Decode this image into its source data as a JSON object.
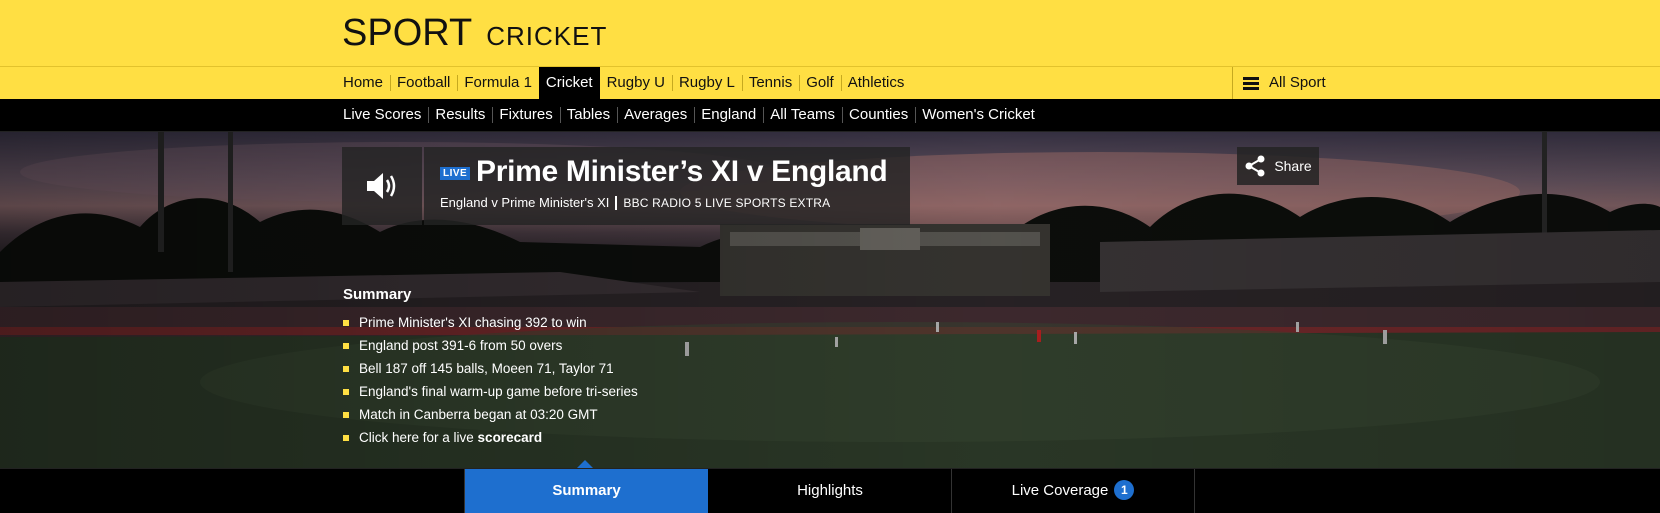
{
  "masthead": {
    "brand": "SPORT",
    "section": "CRICKET"
  },
  "primary_nav": {
    "items": [
      {
        "label": "Home"
      },
      {
        "label": "Football"
      },
      {
        "label": "Formula 1"
      },
      {
        "label": "Cricket",
        "active": true
      },
      {
        "label": "Rugby U"
      },
      {
        "label": "Rugby L"
      },
      {
        "label": "Tennis"
      },
      {
        "label": "Golf"
      },
      {
        "label": "Athletics"
      }
    ],
    "all_sport_label": "All Sport"
  },
  "secondary_nav": {
    "items": [
      {
        "label": "Live Scores"
      },
      {
        "label": "Results"
      },
      {
        "label": "Fixtures"
      },
      {
        "label": "Tables"
      },
      {
        "label": "Averages"
      },
      {
        "label": "England"
      },
      {
        "label": "All Teams"
      },
      {
        "label": "Counties"
      },
      {
        "label": "Women's Cricket"
      }
    ]
  },
  "hero": {
    "live_badge": "LIVE",
    "title": "Prime Minister’s XI v England",
    "subtitle": "England v Prime Minister's XI",
    "station": "BBC RADIO 5 LIVE SPORTS EXTRA",
    "share_label": "Share",
    "icons": {
      "audio": "speaker-icon",
      "share": "share-icon",
      "menu": "hamburger-icon"
    }
  },
  "summary": {
    "heading": "Summary",
    "items": [
      "Prime Minister's XI chasing 392 to win",
      "England post 391-6 from 50 overs",
      "Bell 187 off 145 balls, Moeen 71, Taylor 71",
      "England's final warm-up game before tri-series",
      "Match in Canberra began at 03:20 GMT"
    ],
    "scorecard_prefix": "Click here for a live ",
    "scorecard_link": "scorecard"
  },
  "tabs": {
    "items": [
      {
        "label": "Summary",
        "active": true
      },
      {
        "label": "Highlights"
      },
      {
        "label": "Live Coverage",
        "count": "1"
      }
    ]
  },
  "colors": {
    "brand_yellow": "#ffdf43",
    "accent_blue": "#1e6fcf",
    "nav_dark": "#000000"
  }
}
